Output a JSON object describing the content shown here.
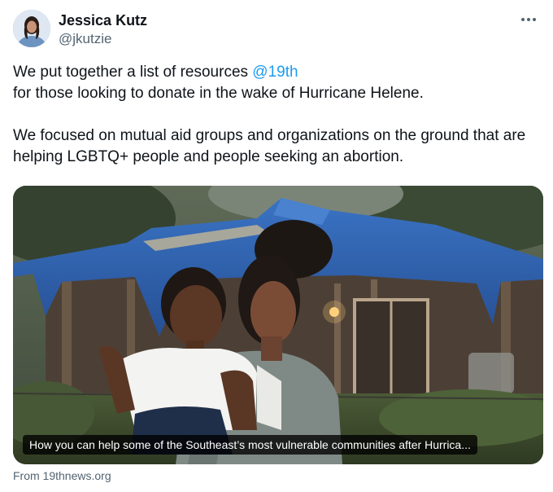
{
  "author": {
    "display_name": "Jessica Kutz",
    "handle": "@jkutzie",
    "avatar_icon": "user-avatar"
  },
  "tweet": {
    "line1_before_mention": "We put together a list of resources ",
    "mention": "@19th",
    "line2": "for those looking to donate in the wake of Hurricane Helene.",
    "paragraph2": "We focused on mutual aid groups and  organizations on the ground that are helping LGBTQ+ people and people seeking an abortion."
  },
  "card": {
    "caption": "How you can help some of the Southeast’s most vulnerable communities after Hurrica...",
    "source": "From 19thnews.org"
  },
  "icons": {
    "more": "more-options-icon"
  },
  "colors": {
    "link": "#1d9bf0",
    "secondary_text": "#536471",
    "tarp_blue": "#2e5fa8"
  }
}
